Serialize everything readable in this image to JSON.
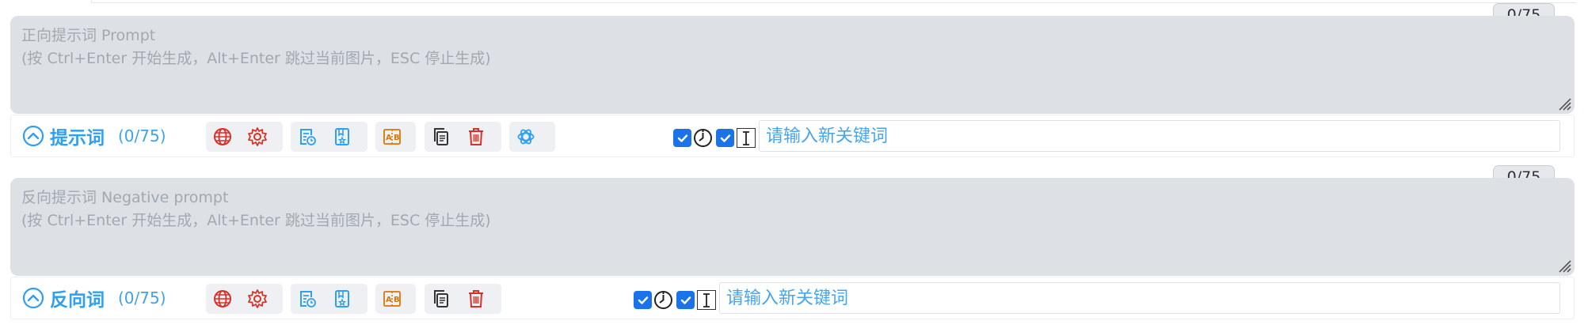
{
  "positive": {
    "placeholder": "正向提示词 Prompt\n(按 Ctrl+Enter 开始生成，Alt+Enter 跳过当前图片，ESC 停止生成)",
    "token_counter": "0/75",
    "title": "提示词",
    "count": "(0/75)",
    "keyword_placeholder": "请输入新关键词",
    "icons": [
      "globe-icon",
      "gear-icon",
      "history-icon",
      "bookmark-icon",
      "translate-icon",
      "copy-icon",
      "trash-icon",
      "openai-icon"
    ]
  },
  "negative": {
    "placeholder": "反向提示词 Negative prompt\n(按 Ctrl+Enter 开始生成，Alt+Enter 跳过当前图片，ESC 停止生成)",
    "token_counter": "0/75",
    "title": "反向词",
    "count": "(0/75)",
    "keyword_placeholder": "请输入新关键词",
    "icons": [
      "globe-icon",
      "gear-icon",
      "history-icon",
      "bookmark-icon",
      "translate-icon",
      "copy-icon",
      "trash-icon"
    ]
  },
  "colors": {
    "accent": "#2f9ff0",
    "danger": "#d93025",
    "translate": "#d97706",
    "checkbox": "#1a73e8",
    "textarea_bg": "#dde1e6"
  }
}
